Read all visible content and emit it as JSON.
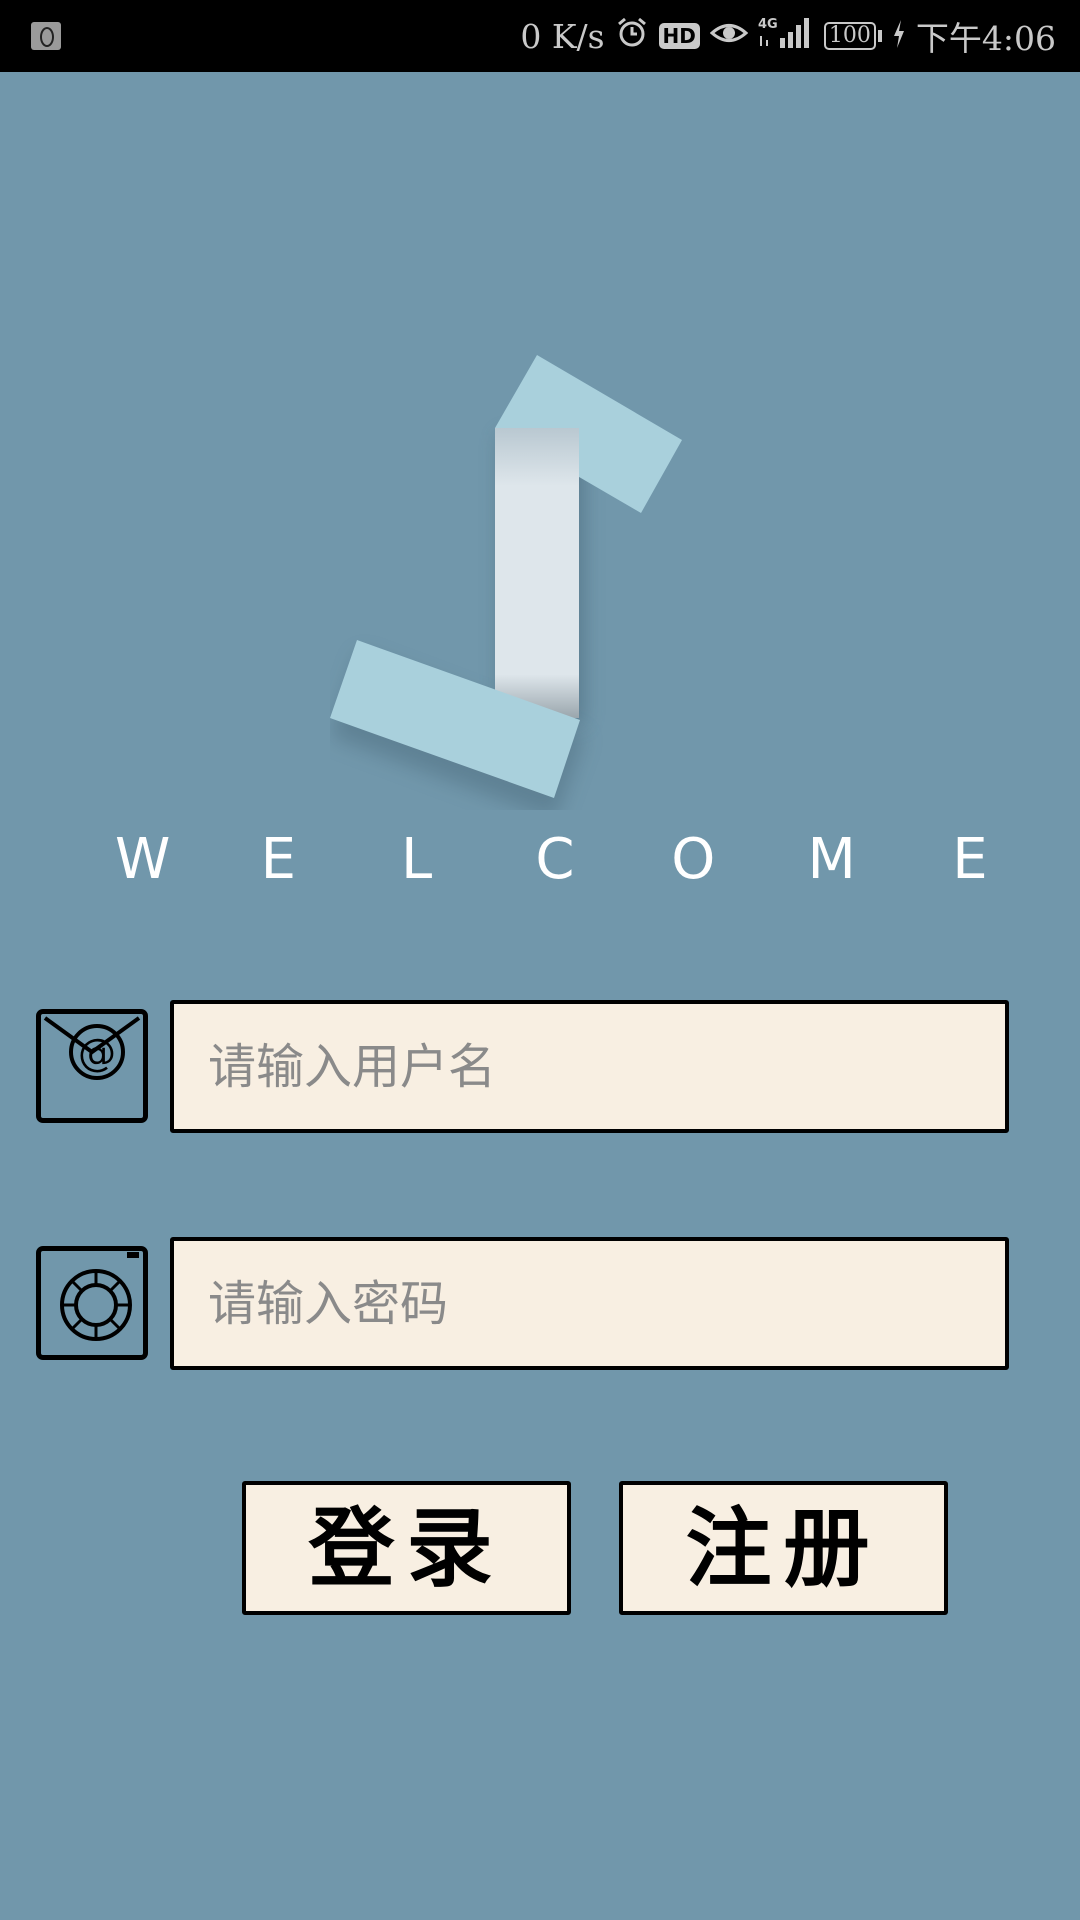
{
  "status_bar": {
    "net_speed": "0 K/s",
    "hd_label": "HD",
    "network_label": "4G",
    "battery": "100",
    "time": "下午4:06",
    "icons": [
      "app-notification-icon",
      "alarm-icon",
      "hd-icon",
      "eye-icon",
      "signal-icon",
      "battery-icon",
      "charging-icon"
    ]
  },
  "logo": {
    "welcome_letters": [
      "W",
      "E",
      "L",
      "C",
      "O",
      "M",
      "E"
    ]
  },
  "form": {
    "username": {
      "placeholder": "请输入用户名",
      "icon": "email-at-icon"
    },
    "password": {
      "placeholder": "请输入密码",
      "icon": "lifebuoy-icon"
    }
  },
  "buttons": {
    "login_label": "登录",
    "register_label": "注册"
  },
  "colors": {
    "background": "#7197ab",
    "field_fill": "#f8efe2",
    "logo_block": "#a9d0dc",
    "logo_stem": "#dde5ea"
  }
}
